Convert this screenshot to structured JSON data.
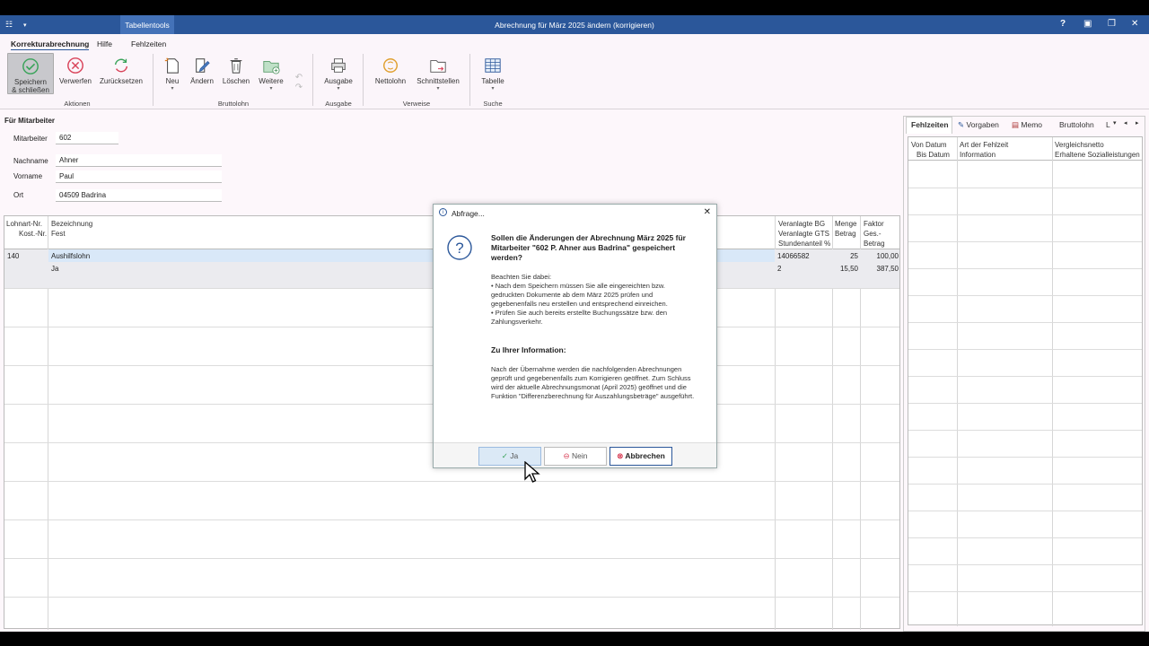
{
  "window": {
    "title": "Abrechnung für März 2025 ändern (korrigieren)",
    "context_tab": "Tabellentools",
    "help": "?"
  },
  "menu": {
    "items": [
      "Korrekturabrechnung",
      "Hilfe",
      "Fehlzeiten"
    ]
  },
  "ribbon": {
    "speichern": "Speichern",
    "schliessen": "& schließen",
    "verwerfen": "Verwerfen",
    "zuruecksetzen": "Zurücksetzen",
    "group_aktionen": "Aktionen",
    "neu": "Neu",
    "aendern": "Ändern",
    "loeschen": "Löschen",
    "weitere": "Weitere",
    "group_bruttolohn": "Bruttolohn",
    "ausgabe": "Ausgabe",
    "group_ausgabe": "Ausgabe",
    "nettolohn": "Nettolohn",
    "schnittstellen": "Schnittstellen",
    "group_verweise": "Verweise",
    "tabelle": "Tabelle",
    "group_suche": "Suche"
  },
  "employee": {
    "section": "Für Mitarbeiter",
    "mitarbeiter_label": "Mitarbeiter",
    "mitarbeiter": "602",
    "nachname_label": "Nachname",
    "nachname": "Ahner",
    "vorname_label": "Vorname",
    "vorname": "Paul",
    "ort_label": "Ort",
    "ort": "04509 Badrina"
  },
  "grid": {
    "h1a": "Lohnart-Nr.",
    "h1b": "Kost.-Nr.",
    "h2a": "Bezeichnung",
    "h2b": "Fest",
    "h3a": "Veranlagte BG",
    "h3b": "Veranlagte GTS",
    "h3c": "Stundenanteil %",
    "h4a": "Menge",
    "h4b": "Betrag",
    "h5a": "Faktor",
    "h5b": "Ges.-Betrag",
    "row1": {
      "nr": "140",
      "bez": "Aushilfslohn",
      "bg": "14066582",
      "menge": "25",
      "faktor": "100,00"
    },
    "row2": {
      "fest": "Ja",
      "gts": "2",
      "betrag": "15,50",
      "ges": "387,50"
    }
  },
  "right": {
    "tabs": [
      "Fehlzeiten",
      "Vorgaben",
      "Memo",
      "Bruttolohn",
      "L"
    ],
    "h1a": "Von Datum",
    "h1b": "Bis Datum",
    "h2a": "Art der Fehlzeit",
    "h2b": "Information",
    "h3a": "Vergleichsnetto",
    "h3b": "Erhaltene Sozialleistungen"
  },
  "dialog": {
    "title": "Abfrage...",
    "question_line1": "Sollen die Änderungen der Abrechnung März 2025 für",
    "question_line2": "Mitarbeiter \"602 P. Ahner aus Badrina\" gespeichert",
    "question_line3": "werden?",
    "note_head": "Beachten Sie dabei:",
    "note1_line1": "•    Nach dem Speichern müssen Sie alle eingereichten bzw.",
    "note1_line2": "gedruckten Dokumente ab dem März 2025 prüfen und",
    "note1_line3": "gegebenenfalls neu erstellen und entsprechend einreichen.",
    "note2_line1": "•    Prüfen Sie auch bereits erstellte Buchungssätze bzw. den",
    "note2_line2": "Zahlungsverkehr.",
    "info_head": "Zu Ihrer Information:",
    "info_line1": "Nach der Übernahme werden die nachfolgenden Abrechnungen",
    "info_line2": "geprüft und gegebenenfalls zum Korrigieren geöffnet. Zum Schluss",
    "info_line3": "wird der aktuelle Abrechnungsmonat (April 2025) geöffnet und die",
    "info_line4": "Funktion \"Differenzberechnung für Auszahlungsbeträge\" ausgeführt.",
    "btn_ja": "Ja",
    "btn_nein": "Nein",
    "btn_abbrechen": "Abbrechen"
  }
}
